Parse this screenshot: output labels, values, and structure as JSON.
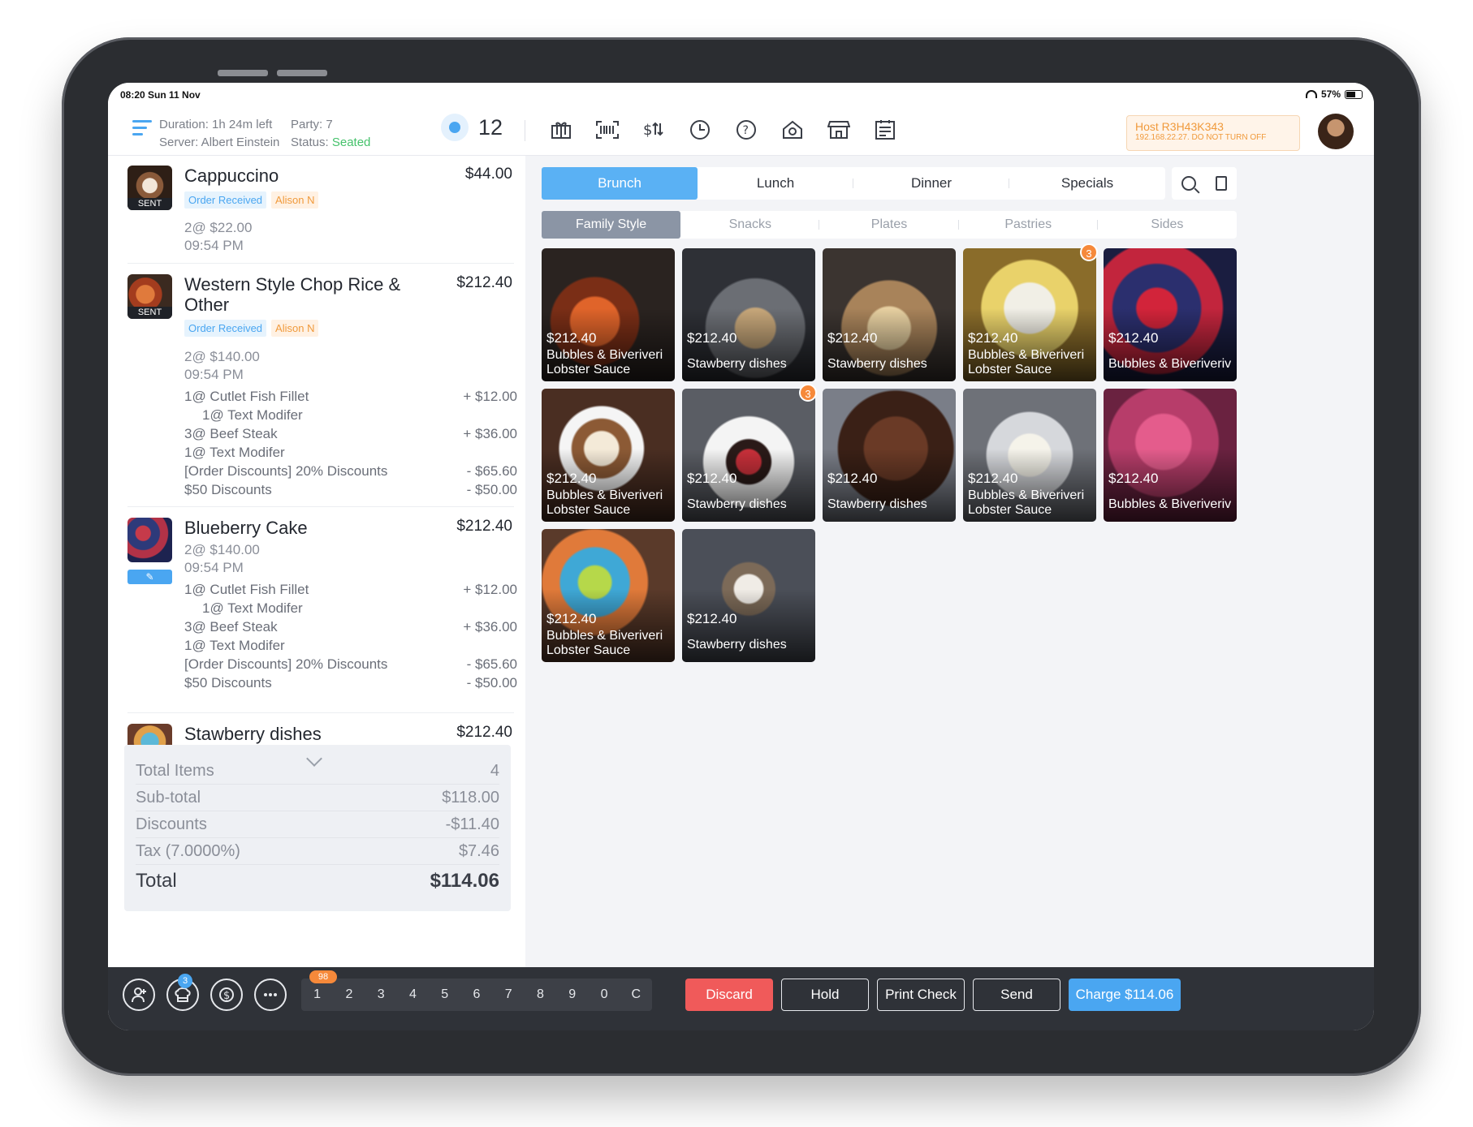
{
  "status_bar": {
    "time": "08:20  Sun 11 Nov",
    "battery": "57%"
  },
  "header": {
    "duration": "Duration: 1h 24m left",
    "server": "Server: Albert Einstein",
    "party": "Party: 7",
    "status_label": "Status: ",
    "status_value": "Seated",
    "table_number": "12",
    "host_title": "Host R3H43K343",
    "host_sub": "192.168.22.27. DO NOT TURN OFF",
    "tool_icons": [
      "gift-icon",
      "barcode-icon",
      "price-swap-icon",
      "clock-icon",
      "help-icon",
      "camera-scan-icon",
      "store-icon",
      "report-icon"
    ]
  },
  "order": {
    "items": [
      {
        "name": "Cappuccino",
        "price": "$44.00",
        "sent": "SENT",
        "tag_status": "Order Received",
        "tag_staff": "Alison N",
        "qty": "2@ $22.00",
        "time": "09:54 PM"
      },
      {
        "name": "Western Style Chop Rice & Other",
        "price": "$212.40",
        "sent": "SENT",
        "tag_status": "Order Received",
        "tag_staff": "Alison N",
        "qty": "2@ $140.00",
        "time": "09:54 PM",
        "mods": [
          {
            "label": "1@ Cutlet Fish Fillet",
            "value": "+ $12.00"
          },
          {
            "label": "1@ Text Modifer",
            "value": ""
          },
          {
            "label": "3@ Beef Steak",
            "value": "+ $36.00"
          },
          {
            "label": "1@ Text Modifer",
            "value": ""
          },
          {
            "label": "[Order Discounts] 20% Discounts",
            "value": "- $65.60"
          },
          {
            "label": "$50 Discounts",
            "value": "- $50.00"
          }
        ]
      },
      {
        "name": "Blueberry Cake",
        "price": "$212.40",
        "qty": "2@ $140.00",
        "time": "09:54 PM",
        "mods": [
          {
            "label": "1@ Cutlet Fish Fillet",
            "value": "+ $12.00"
          },
          {
            "label": "1@ Text Modifer",
            "value": ""
          },
          {
            "label": "3@ Beef Steak",
            "value": "+ $36.00"
          },
          {
            "label": "1@ Text Modifer",
            "value": ""
          },
          {
            "label": "[Order Discounts] 20% Discounts",
            "value": "- $65.60"
          },
          {
            "label": "$50 Discounts",
            "value": "- $50.00"
          }
        ]
      },
      {
        "name": "Stawberry dishes",
        "price": "$212.40"
      }
    ],
    "summary": {
      "total_items_label": "Total Items",
      "total_items": "4",
      "subtotal_label": "Sub-total",
      "subtotal": "$118.00",
      "discounts_label": "Discounts",
      "discounts": "-$11.40",
      "tax_label": "Tax (7.0000%)",
      "tax": "$7.46",
      "total_label": "Total",
      "total": "$114.06"
    }
  },
  "menu": {
    "categories": [
      "Brunch",
      "Lunch",
      "Dinner",
      "Specials"
    ],
    "active_category": "Brunch",
    "subcategories": [
      "Family Style",
      "Snacks",
      "Plates",
      "Pastries",
      "Sides"
    ],
    "active_subcategory": "Family Style",
    "items": [
      {
        "price": "$212.40",
        "name1": "Bubbles & Biveriveri",
        "name2": "Lobster Sauce",
        "badge": ""
      },
      {
        "price": "$212.40",
        "name1": "Stawberry dishes",
        "name2": "",
        "badge": ""
      },
      {
        "price": "$212.40",
        "name1": "Stawberry dishes",
        "name2": "",
        "badge": ""
      },
      {
        "price": "$212.40",
        "name1": "Bubbles & Biveriveri",
        "name2": "Lobster Sauce",
        "badge": "3"
      },
      {
        "price": "$212.40",
        "name1": "Bubbles & Biveriveriv",
        "name2": "",
        "badge": ""
      },
      {
        "price": "$212.40",
        "name1": "Bubbles & Biveriveri",
        "name2": "Lobster Sauce",
        "badge": ""
      },
      {
        "price": "$212.40",
        "name1": "Stawberry dishes",
        "name2": "",
        "badge": "3"
      },
      {
        "price": "$212.40",
        "name1": "Stawberry dishes",
        "name2": "",
        "badge": ""
      },
      {
        "price": "$212.40",
        "name1": "Bubbles & Biveriveri",
        "name2": "Lobster Sauce",
        "badge": ""
      },
      {
        "price": "$212.40",
        "name1": "Bubbles & Biveriveriv",
        "name2": "",
        "badge": ""
      },
      {
        "price": "$212.40",
        "name1": "Bubbles & Biveriveri",
        "name2": "Lobster Sauce",
        "badge": ""
      },
      {
        "price": "$212.40",
        "name1": "Stawberry dishes",
        "name2": "",
        "badge": ""
      }
    ]
  },
  "bottom": {
    "chef_badge": "3",
    "numpad": [
      "1",
      "2",
      "3",
      "4",
      "5",
      "6",
      "7",
      "8",
      "9",
      "0",
      "C"
    ],
    "numpad_badge": "98",
    "discard": "Discard",
    "hold": "Hold",
    "print_check": "Print Check",
    "send": "Send",
    "charge": "Charge $114.06"
  },
  "colors": {
    "accent": "#4aa6f1",
    "danger": "#f05a5a",
    "badge": "#f6893a",
    "bar": "#2f3238"
  }
}
